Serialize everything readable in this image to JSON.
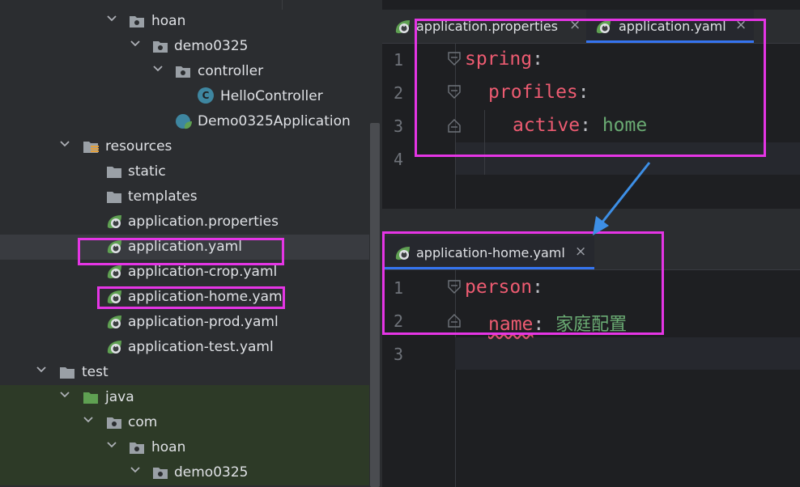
{
  "tree": {
    "items": [
      {
        "label": "hoan",
        "icon": "package-icon"
      },
      {
        "label": "demo0325",
        "icon": "package-icon"
      },
      {
        "label": "controller",
        "icon": "package-icon"
      },
      {
        "label": "HelloController",
        "icon": "class-icon",
        "icon_letter": "C"
      },
      {
        "label": "Demo0325Application",
        "icon": "spring-class-icon"
      },
      {
        "label": "resources",
        "icon": "resources-folder-icon"
      },
      {
        "label": "static",
        "icon": "folder-icon"
      },
      {
        "label": "templates",
        "icon": "folder-icon"
      },
      {
        "label": "application.properties",
        "icon": "spring-config-icon"
      },
      {
        "label": "application.yaml",
        "icon": "spring-config-icon"
      },
      {
        "label": "application-crop.yaml",
        "icon": "spring-config-icon"
      },
      {
        "label": "application-home.yaml",
        "icon": "spring-config-icon"
      },
      {
        "label": "application-prod.yaml",
        "icon": "spring-config-icon"
      },
      {
        "label": "application-test.yaml",
        "icon": "spring-config-icon"
      },
      {
        "label": "test",
        "icon": "folder-icon"
      },
      {
        "label": "java",
        "icon": "test-source-folder-icon"
      },
      {
        "label": "com",
        "icon": "package-icon"
      },
      {
        "label": "hoan",
        "icon": "package-icon"
      },
      {
        "label": "demo0325",
        "icon": "package-icon"
      }
    ]
  },
  "editor_top": {
    "tabs": [
      {
        "label": "application.properties",
        "close": "×"
      },
      {
        "label": "application.yaml",
        "close": "×"
      }
    ],
    "line_numbers": [
      "1",
      "2",
      "3",
      "4"
    ],
    "code": {
      "l1_key": "spring",
      "l1_colon": ":",
      "l2_key": "profiles",
      "l2_colon": ":",
      "l3_key": "active",
      "l3_colon": ":",
      "l3_value": "home"
    }
  },
  "editor_bottom": {
    "tab": {
      "label": "application-home.yaml",
      "close": "×"
    },
    "line_numbers": [
      "1",
      "2",
      "3"
    ],
    "code": {
      "l1_key": "person",
      "l1_colon": ":",
      "l2_key": "name",
      "l2_colon": ":",
      "l2_value": "家庭配置"
    }
  },
  "colors": {
    "highlight": "#e535e5",
    "arrow": "#3d8fe6",
    "yaml_key": "#ed5b71",
    "yaml_value": "#6aab73",
    "tab_underline": "#3574f0"
  }
}
